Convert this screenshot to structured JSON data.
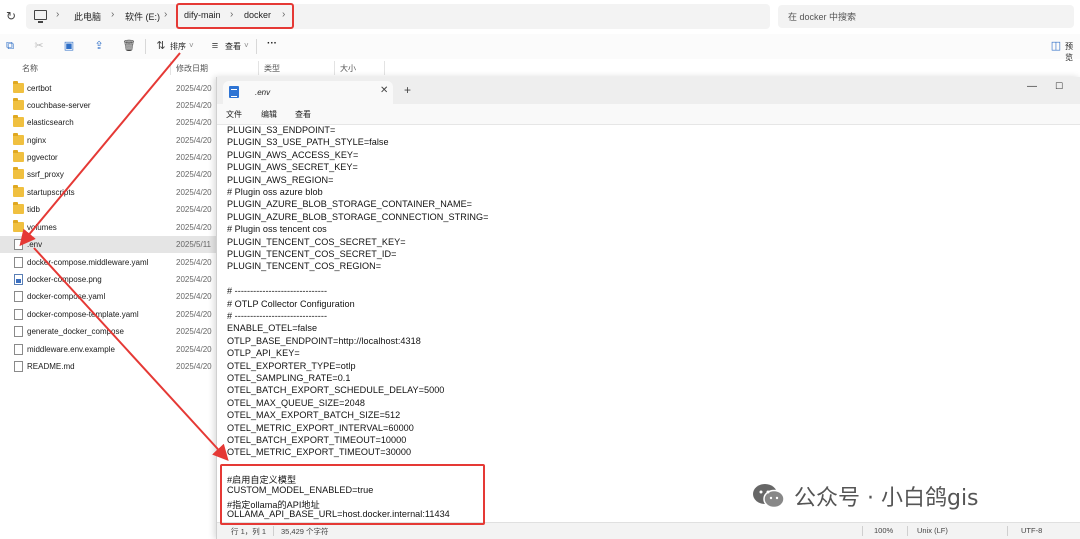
{
  "address_bar": {
    "crumbs": [
      "此电脑",
      "软件 (E:)",
      "dify-main",
      "docker"
    ],
    "search_placeholder": "在 docker 中搜索"
  },
  "toolbar": {
    "sort_label": "排序",
    "view_label": "查看",
    "more_label": "···",
    "preview_label": "预览"
  },
  "file_list": {
    "columns": [
      "名称",
      "修改日期",
      "类型",
      "大小"
    ],
    "files": [
      {
        "name": "certbot",
        "date": "2025/4/20",
        "kind": "folder"
      },
      {
        "name": "couchbase-server",
        "date": "2025/4/20",
        "kind": "folder"
      },
      {
        "name": "elasticsearch",
        "date": "2025/4/20",
        "kind": "folder"
      },
      {
        "name": "nginx",
        "date": "2025/4/20",
        "kind": "folder"
      },
      {
        "name": "pgvector",
        "date": "2025/4/20",
        "kind": "folder"
      },
      {
        "name": "ssrf_proxy",
        "date": "2025/4/20",
        "kind": "folder"
      },
      {
        "name": "startupscripts",
        "date": "2025/4/20",
        "kind": "folder"
      },
      {
        "name": "tidb",
        "date": "2025/4/20",
        "kind": "folder"
      },
      {
        "name": "volumes",
        "date": "2025/4/20",
        "kind": "folder"
      },
      {
        "name": ".env",
        "date": "2025/5/11",
        "kind": "file",
        "selected": true
      },
      {
        "name": "docker-compose.middleware.yaml",
        "date": "2025/4/20",
        "kind": "file"
      },
      {
        "name": "docker-compose.png",
        "date": "2025/4/20",
        "kind": "image"
      },
      {
        "name": "docker-compose.yaml",
        "date": "2025/4/20",
        "kind": "file"
      },
      {
        "name": "docker-compose-template.yaml",
        "date": "2025/4/20",
        "kind": "file"
      },
      {
        "name": "generate_docker_compose",
        "date": "2025/4/20",
        "kind": "file"
      },
      {
        "name": "middleware.env.example",
        "date": "2025/4/20",
        "kind": "file"
      },
      {
        "name": "README.md",
        "date": "2025/4/20",
        "kind": "file"
      }
    ]
  },
  "notepad": {
    "tab_title": ".env",
    "menu": [
      "文件",
      "编辑",
      "查看"
    ],
    "lines": [
      "PLUGIN_S3_ENDPOINT=",
      "PLUGIN_S3_USE_PATH_STYLE=false",
      "PLUGIN_AWS_ACCESS_KEY=",
      "PLUGIN_AWS_SECRET_KEY=",
      "PLUGIN_AWS_REGION=",
      "# Plugin oss azure blob",
      "PLUGIN_AZURE_BLOB_STORAGE_CONTAINER_NAME=",
      "PLUGIN_AZURE_BLOB_STORAGE_CONNECTION_STRING=",
      "# Plugin oss tencent cos",
      "PLUGIN_TENCENT_COS_SECRET_KEY=",
      "PLUGIN_TENCENT_COS_SECRET_ID=",
      "PLUGIN_TENCENT_COS_REGION=",
      "",
      "# ------------------------------",
      "# OTLP Collector Configuration",
      "# ------------------------------",
      "ENABLE_OTEL=false",
      "OTLP_BASE_ENDPOINT=http://localhost:4318",
      "OTLP_API_KEY=",
      "OTEL_EXPORTER_TYPE=otlp",
      "OTEL_SAMPLING_RATE=0.1",
      "OTEL_BATCH_EXPORT_SCHEDULE_DELAY=5000",
      "OTEL_MAX_QUEUE_SIZE=2048",
      "OTEL_MAX_EXPORT_BATCH_SIZE=512",
      "OTEL_METRIC_EXPORT_INTERVAL=60000",
      "OTEL_BATCH_EXPORT_TIMEOUT=10000",
      "OTEL_METRIC_EXPORT_TIMEOUT=30000",
      "",
      "#启用自定义模型",
      "CUSTOM_MODEL_ENABLED=true",
      "#指定ollama的API地址",
      "OLLAMA_API_BASE_URL=host.docker.internal:11434"
    ],
    "status": {
      "position": "行 1，列 1",
      "chars": "35,429 个字符",
      "zoom": "100%",
      "eol": "Unix (LF)",
      "encoding": "UTF-8"
    }
  },
  "watermark": {
    "text": "公众号 · 小白鸽gis"
  }
}
